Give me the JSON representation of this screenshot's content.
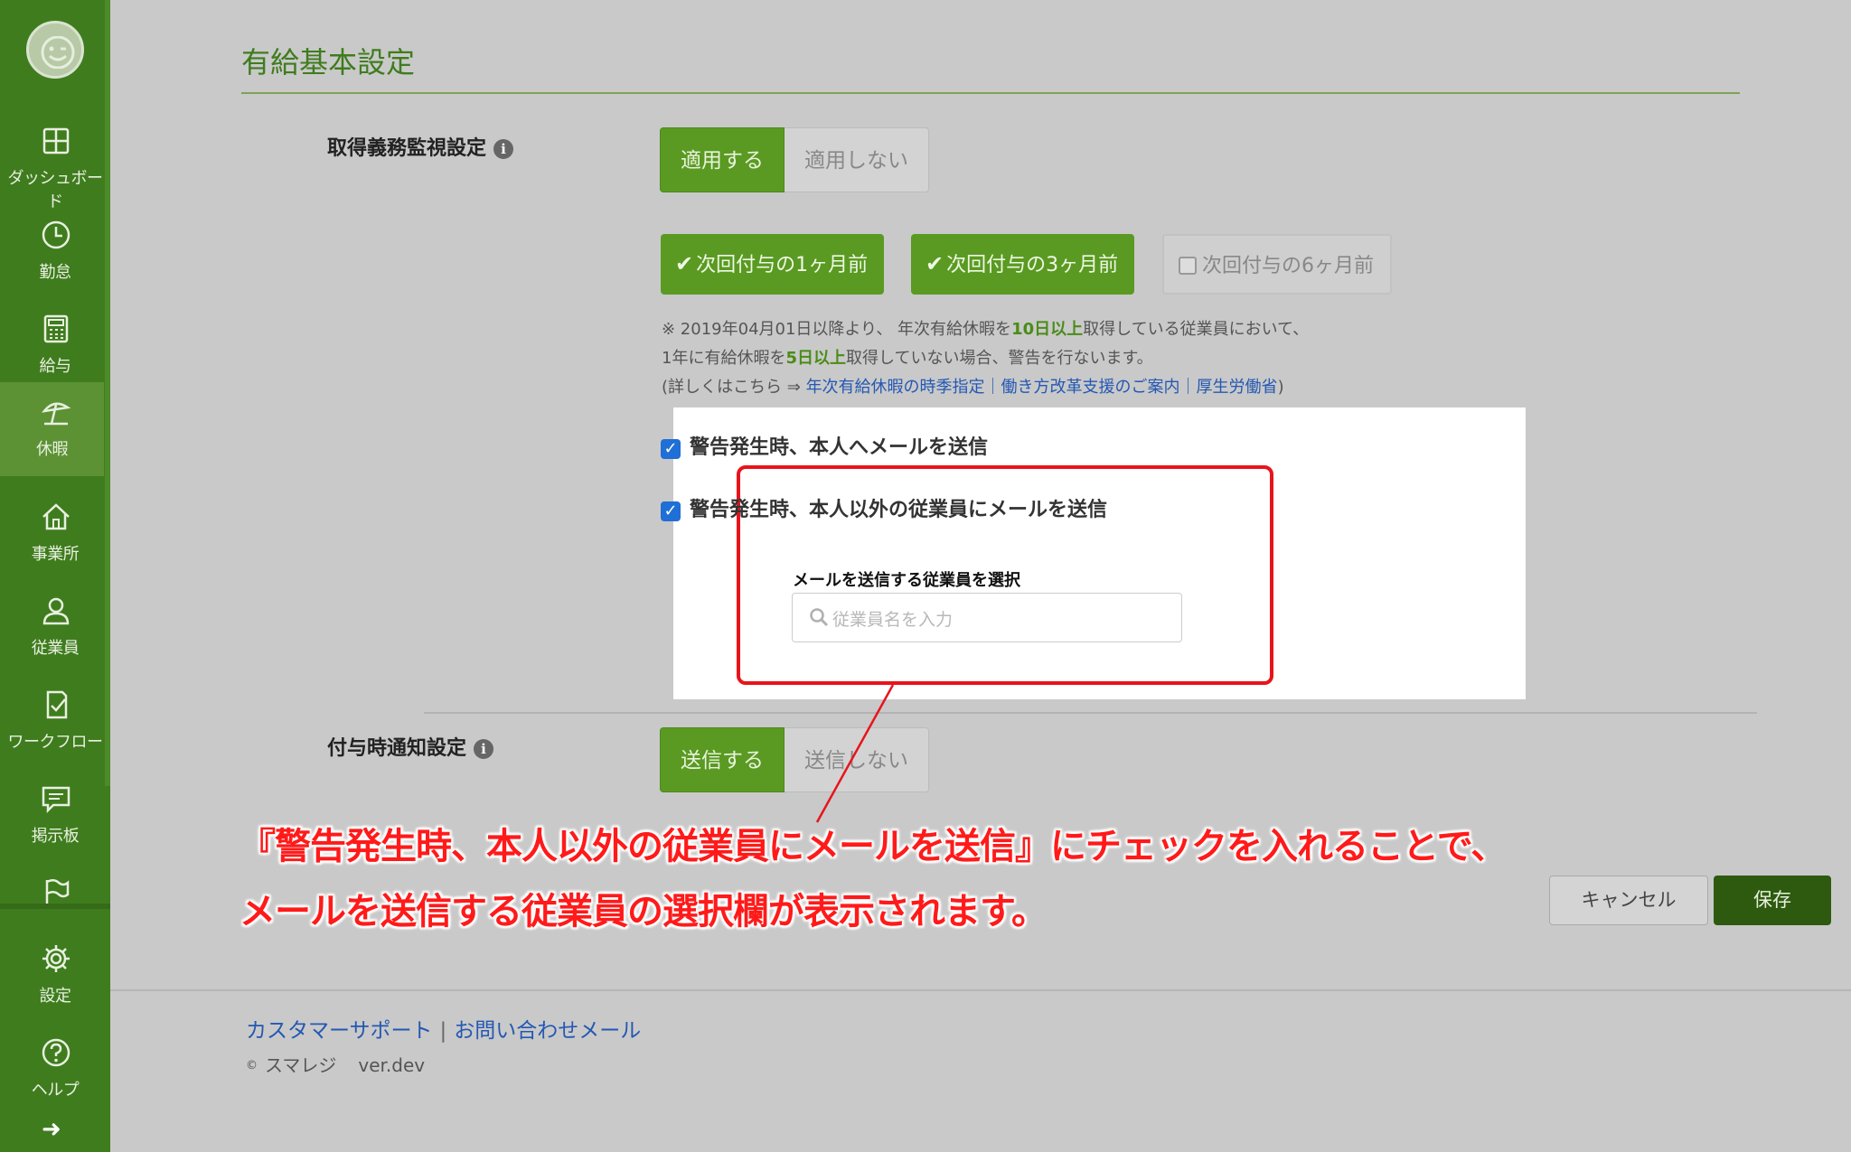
{
  "sidebar": {
    "items": [
      {
        "label": "ダッシュボード",
        "icon": "dashboard-icon"
      },
      {
        "label": "勤怠",
        "icon": "clock-icon"
      },
      {
        "label": "給与",
        "icon": "calculator-icon"
      },
      {
        "label": "休暇",
        "icon": "beach-umbrella-icon",
        "active": true
      },
      {
        "label": "事業所",
        "icon": "home-icon"
      },
      {
        "label": "従業員",
        "icon": "user-icon"
      },
      {
        "label": "ワークフロー",
        "icon": "workflow-icon"
      },
      {
        "label": "掲示板",
        "icon": "message-icon"
      },
      {
        "label": "",
        "icon": "flag-icon"
      },
      {
        "label": "設定",
        "icon": "gear-icon"
      },
      {
        "label": "ヘルプ",
        "icon": "help-icon"
      }
    ],
    "expand_glyph": "➜"
  },
  "page": {
    "title": "有給基本設定"
  },
  "obligation": {
    "label": "取得義務監視設定",
    "info_glyph": "i",
    "apply_label": "適用する",
    "not_apply_label": "適用しない",
    "selected": "適用する",
    "timing": [
      {
        "label": "次回付与の1ヶ月前",
        "checked": true
      },
      {
        "label": "次回付与の3ヶ月前",
        "checked": true
      },
      {
        "label": "次回付与の6ヶ月前",
        "checked": false
      }
    ],
    "check_glyph": "✔",
    "note": {
      "line1_a": "※ 2019年04月01日以降より、 年次有給休暇を",
      "line1_hl": "10日以上",
      "line1_b": "取得している従業員において、",
      "line2_a": "1年に有給休暇を",
      "line2_hl": "5日以上",
      "line2_b": "取得していない場合、警告を行ないます。",
      "line3_a": "(詳しくはこちら ⇒ ",
      "line3_link": "年次有給休暇の時季指定｜働き方改革支援のご案内｜厚生労働省",
      "line3_b": ")"
    },
    "mail_self": {
      "label": "警告発生時、本人へメールを送信",
      "checked": true
    },
    "mail_others": {
      "label": "警告発生時、本人以外の従業員にメールを送信",
      "checked": true
    },
    "select_employee_label": "メールを送信する従業員を選択",
    "search_placeholder": "従業員名を入力"
  },
  "notify": {
    "label": "付与時通知設定",
    "send_label": "送信する",
    "not_send_label": "送信しない",
    "selected": "送信する"
  },
  "annotation": {
    "line1": "『警告発生時、本人以外の従業員にメールを送信』にチェックを入れることで、",
    "line2": "メールを送信する従業員の選択欄が表示されます。",
    "color": "#ff1a1a"
  },
  "actions": {
    "cancel_label": "キャンセル",
    "save_label": "保存"
  },
  "footer": {
    "support_link": "カスタマーサポート",
    "separator": "|",
    "contact_link": "お問い合わせメール",
    "copyright_symbol": "©",
    "company": "スマレジ",
    "version": "ver.dev"
  },
  "colors": {
    "brand_green": "#3f7c1e",
    "button_green": "#5a9a22",
    "save_green": "#2d5a0f",
    "link_blue": "#2458b3",
    "highlight_red": "#e8141b"
  }
}
